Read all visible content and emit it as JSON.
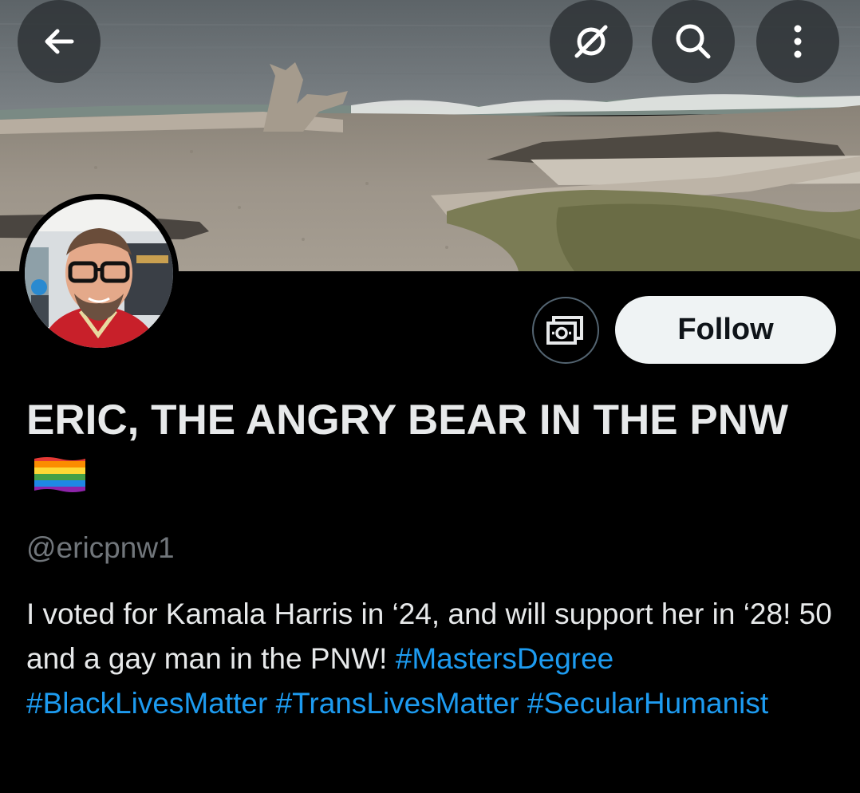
{
  "header": {
    "buttons": [
      {
        "name": "back",
        "icon": "arrow-left-icon"
      },
      {
        "name": "grok",
        "icon": "grok-slash-icon"
      },
      {
        "name": "search",
        "icon": "search-icon"
      },
      {
        "name": "more",
        "icon": "more-vertical-icon"
      }
    ],
    "banner": "beach-driftwood-banner"
  },
  "profile": {
    "display_name": "ERIC, THE ANGRY BEAR IN THE PNW",
    "display_name_emoji": "rainbow-flag",
    "handle": "@ericpnw1",
    "bio_text": "I voted for Kamala Harris in ‘24, and will support her in ‘28! 50 and a gay man in the PNW!",
    "hashtags": [
      "#MastersDegree",
      "#BlackLivesMatter",
      "#TransLivesMatter",
      "#SecularHumanist"
    ]
  },
  "actions": {
    "subscribe_icon": "money-subscribe-icon",
    "follow_label": "Follow"
  },
  "colors": {
    "background": "#000000",
    "text": "#e7e9ea",
    "muted": "#71767b",
    "link": "#1d9bf0",
    "follow_bg": "#eff3f4",
    "follow_text": "#0f1419"
  }
}
